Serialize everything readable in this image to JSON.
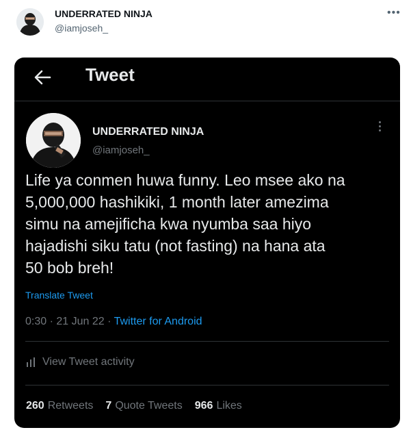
{
  "outer": {
    "name": "UNDERRATED NINJA",
    "handle": "@iamjoseh_",
    "more_icon": "more-horizontal-icon"
  },
  "card": {
    "header_title": "Tweet",
    "back_icon": "arrow-left-icon"
  },
  "tweet": {
    "author_name": "UNDERRATED NINJA",
    "author_handle": "@iamjoseh_",
    "text": "Life ya conmen huwa funny. Leo msee ako na\n5,000,000 hashikiki, 1 month later amezima\nsimu na amejificha kwa nyumba saa hiyo\nhajadishi siku tatu (not fasting) na hana ata\n50 bob breh!",
    "translate_label": "Translate Tweet",
    "time": "0:30",
    "separator": " · ",
    "date": "21 Jun 22",
    "source": "Twitter for Android",
    "activity_label": "View Tweet activity"
  },
  "stats": {
    "retweets_count": "260",
    "retweets_label": "Retweets",
    "quotes_count": "7",
    "quotes_label": "Quote Tweets",
    "likes_count": "966",
    "likes_label": "Likes"
  },
  "colors": {
    "card_bg": "#000000",
    "text_primary": "#e7e9ea",
    "text_secondary": "#71767b",
    "link": "#1d9bf0",
    "divider": "#2f3336"
  }
}
